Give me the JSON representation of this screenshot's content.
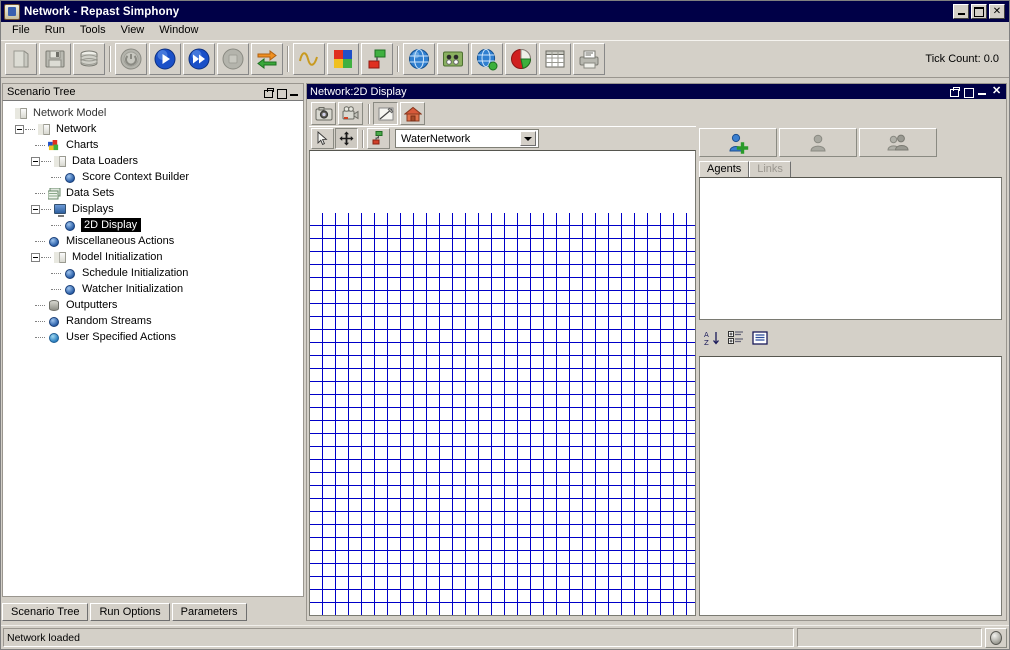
{
  "window": {
    "title": "Network - Repast Simphony",
    "app_icon": "java-coffee-icon",
    "controls": {
      "minimize": "_",
      "maximize": "□",
      "close": "✕"
    }
  },
  "menubar": {
    "items": [
      "File",
      "Run",
      "Tools",
      "View",
      "Window"
    ]
  },
  "toolbar": {
    "tick_count_label": "Tick Count: 0.0",
    "buttons": [
      {
        "name": "open-scenario-button",
        "icon": "open-book-icon",
        "enabled": true
      },
      {
        "name": "save-scenario-button",
        "icon": "floppy-disk-icon",
        "enabled": true
      },
      {
        "name": "database-button",
        "icon": "database-icon",
        "enabled": true
      },
      {
        "name": "init-run-button",
        "icon": "power-init-icon",
        "enabled": false
      },
      {
        "name": "start-run-button",
        "icon": "play-icon",
        "enabled": true
      },
      {
        "name": "step-run-button",
        "icon": "fast-forward-icon",
        "enabled": true
      },
      {
        "name": "stop-run-button",
        "icon": "stop-icon",
        "enabled": false
      },
      {
        "name": "reset-run-button",
        "icon": "reset-arrows-icon",
        "enabled": true
      },
      {
        "name": "add-chart-button",
        "icon": "sine-wave-icon",
        "enabled": true
      },
      {
        "name": "add-histogram-button",
        "icon": "colored-squares-icon",
        "enabled": true
      },
      {
        "name": "add-data-set-button",
        "icon": "dataset-nodes-icon",
        "enabled": true
      },
      {
        "name": "add-display-button",
        "icon": "blue-globe-icon",
        "enabled": true
      },
      {
        "name": "add-network-button",
        "icon": "network-board-icon",
        "enabled": true
      },
      {
        "name": "add-geography-button",
        "icon": "globe-green-dot-icon",
        "enabled": true
      },
      {
        "name": "add-pie-chart-button",
        "icon": "pie-chart-icon",
        "enabled": true
      },
      {
        "name": "add-table-button",
        "icon": "table-grid-icon",
        "enabled": true
      },
      {
        "name": "add-outputter-button",
        "icon": "printer-output-icon",
        "enabled": true
      }
    ]
  },
  "scenario_tree": {
    "panel_title": "Scenario Tree",
    "panel_buttons": [
      "float",
      "maximize",
      "minimize"
    ],
    "nodes": [
      {
        "label": "Network Model",
        "icon": "folder-icon",
        "depth": 0,
        "expander": "none",
        "selected": false
      },
      {
        "label": "Network",
        "icon": "folder-icon",
        "depth": 1,
        "expander": "minus",
        "selected": false
      },
      {
        "label": "Charts",
        "icon": "chart-icon",
        "depth": 2,
        "expander": "leaf",
        "selected": false
      },
      {
        "label": "Data Loaders",
        "icon": "folder-icon",
        "depth": 2,
        "expander": "minus",
        "selected": false
      },
      {
        "label": "Score Context Builder",
        "icon": "sphere-icon",
        "depth": 3,
        "expander": "leaf",
        "selected": false
      },
      {
        "label": "Data Sets",
        "icon": "datasets-icon",
        "depth": 2,
        "expander": "leaf",
        "selected": false
      },
      {
        "label": "Displays",
        "icon": "monitor-icon",
        "depth": 2,
        "expander": "minus",
        "selected": false
      },
      {
        "label": "2D Display",
        "icon": "sphere-icon",
        "depth": 3,
        "expander": "leaf",
        "selected": true
      },
      {
        "label": "Miscellaneous Actions",
        "icon": "sphere-icon",
        "depth": 2,
        "expander": "leaf",
        "selected": false
      },
      {
        "label": "Model Initialization",
        "icon": "folder-icon",
        "depth": 2,
        "expander": "minus",
        "selected": false
      },
      {
        "label": "Schedule Initialization",
        "icon": "sphere-icon",
        "depth": 3,
        "expander": "leaf",
        "selected": false
      },
      {
        "label": "Watcher Initialization",
        "icon": "sphere-icon",
        "depth": 3,
        "expander": "leaf",
        "selected": false
      },
      {
        "label": "Outputters",
        "icon": "database-icon",
        "depth": 2,
        "expander": "leaf",
        "selected": false
      },
      {
        "label": "Random Streams",
        "icon": "sphere-icon",
        "depth": 2,
        "expander": "leaf",
        "selected": false
      },
      {
        "label": "User Specified Actions",
        "icon": "gear-icon",
        "depth": 2,
        "expander": "leaf",
        "selected": false
      }
    ],
    "tabs": [
      {
        "label": "Scenario Tree",
        "active": true
      },
      {
        "label": "Run Options",
        "active": false
      },
      {
        "label": "Parameters",
        "active": false
      }
    ]
  },
  "display_window": {
    "title": "Network:2D Display",
    "controls": [
      "float",
      "maximize",
      "minimize",
      "close"
    ],
    "toolbar": [
      {
        "name": "snapshot-button",
        "icon": "camera-icon",
        "pressed": false
      },
      {
        "name": "movie-button",
        "icon": "movie-camera-icon",
        "pressed": false
      },
      {
        "name": "edit-display-button",
        "icon": "pencil-line-icon",
        "pressed": true
      },
      {
        "name": "home-view-button",
        "icon": "home-icon",
        "pressed": false
      }
    ],
    "canvas_toolbar": [
      {
        "name": "select-tool-button",
        "icon": "cursor-arrow-icon",
        "pressed": false
      },
      {
        "name": "pan-tool-button",
        "icon": "move-cross-icon",
        "pressed": true
      },
      {
        "name": "layout-tool-button",
        "icon": "network-layout-icon",
        "pressed": false
      }
    ],
    "projection_combo": {
      "value": "WaterNetwork",
      "name": "projection-select"
    },
    "grid": {
      "cell_size_px": 13,
      "line_color": "#0000c8",
      "background": "#ffffff"
    }
  },
  "agents_panel": {
    "buttons": [
      {
        "name": "add-agent-button",
        "icon": "person-plus-icon",
        "enabled": true
      },
      {
        "name": "remove-agent-button",
        "icon": "person-icon",
        "enabled": false
      },
      {
        "name": "agent-group-button",
        "icon": "people-group-icon",
        "enabled": false
      }
    ],
    "tabs": [
      {
        "label": "Agents",
        "active": true,
        "enabled": true
      },
      {
        "label": "Links",
        "active": false,
        "enabled": false
      }
    ],
    "list_items": [],
    "property_toolbar": [
      {
        "name": "sort-alphabetical-button",
        "icon": "sort-az-icon"
      },
      {
        "name": "group-categories-button",
        "icon": "categorized-list-icon"
      },
      {
        "name": "show-description-button",
        "icon": "description-panel-icon"
      }
    ],
    "property_rows": []
  },
  "statusbar": {
    "message": "Network loaded",
    "progress_value": "",
    "indicator_icon": "status-ball-icon"
  },
  "colors": {
    "titlebar_bg": "#000047",
    "chrome_bg": "#d4d0c8",
    "grid_line": "#0000c8",
    "selection_bg": "#000000",
    "selection_fg": "#ffffff"
  }
}
